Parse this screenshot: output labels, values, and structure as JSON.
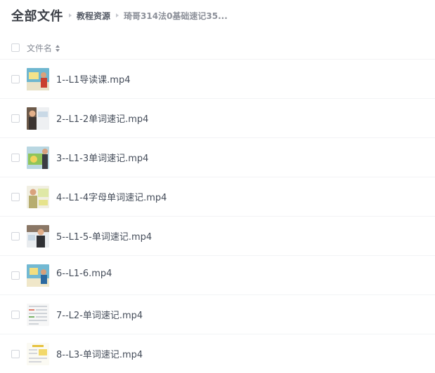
{
  "breadcrumb": {
    "root": "全部文件",
    "middle": "教程资源",
    "current": "琦哥314法0基础速记35..."
  },
  "list_header": {
    "name_column": "文件名"
  },
  "icons": {
    "sort": "sort-icon",
    "separator": "chevron-right-icon",
    "thumbnail": "video-thumbnail"
  },
  "files": [
    {
      "name": "1--L1导读课.mp4"
    },
    {
      "name": "2--L1-2单词速记.mp4"
    },
    {
      "name": "3--L1-3单词速记.mp4"
    },
    {
      "name": "4--L1-4字母单词速记.mp4"
    },
    {
      "name": "5--L1-5-单词速记.mp4"
    },
    {
      "name": "6--L1-6.mp4"
    },
    {
      "name": "7--L2-单词速记.mp4"
    },
    {
      "name": "8--L3-单词速记.mp4"
    }
  ]
}
